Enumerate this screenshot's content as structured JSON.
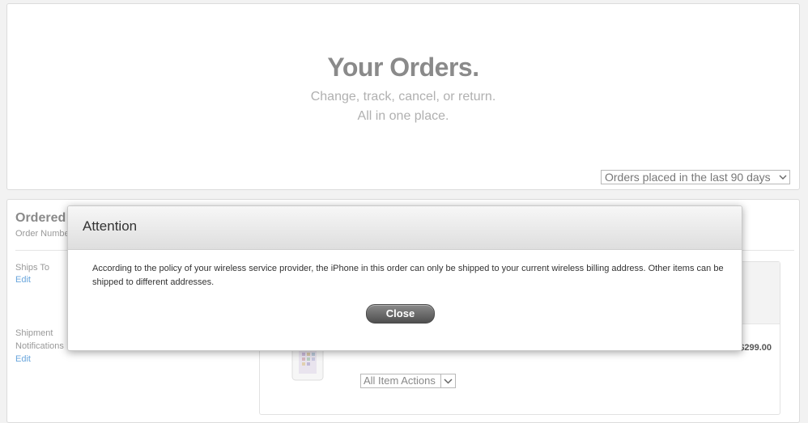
{
  "hero": {
    "title": "Your Orders.",
    "subtitle_line1": "Change, track, cancel, or return.",
    "subtitle_line2": "All in one place.",
    "period_filter": "Orders placed in the last 90 days"
  },
  "order": {
    "title": "Ordered",
    "number_label": "Order Numbe",
    "ships_to_label": "Ships To",
    "ships_to_edit": "Edit",
    "notifications_line1": "Shipment",
    "notifications_line2": "Notifications",
    "notifications_edit": "Edit",
    "item_price": "$299.00",
    "item_actions": "All Item Actions"
  },
  "modal": {
    "title": "Attention",
    "message": "According to the policy of your wireless service provider, the iPhone in this order can only be shipped to your current wireless billing address. Other items can be shipped to different addresses.",
    "close_label": "Close"
  }
}
